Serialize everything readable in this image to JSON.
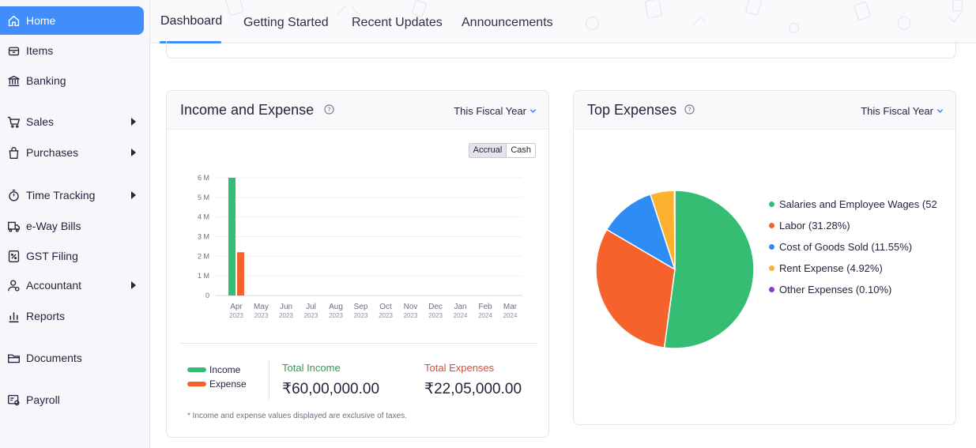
{
  "sidebar": {
    "items": [
      {
        "label": "Home",
        "icon": "home-icon",
        "active": true
      },
      {
        "label": "Items",
        "icon": "box-icon"
      },
      {
        "label": "Banking",
        "icon": "bank-icon"
      },
      {
        "label": "Sales",
        "icon": "cart-icon",
        "submenu": true
      },
      {
        "label": "Purchases",
        "icon": "bag-icon",
        "submenu": true
      },
      {
        "label": "Time Tracking",
        "icon": "stopwatch-icon",
        "submenu": true
      },
      {
        "label": "e-Way Bills",
        "icon": "truck-icon"
      },
      {
        "label": "GST Filing",
        "icon": "percent-doc-icon"
      },
      {
        "label": "Accountant",
        "icon": "accountant-icon",
        "submenu": true
      },
      {
        "label": "Reports",
        "icon": "bar-chart-icon"
      },
      {
        "label": "Documents",
        "icon": "folder-icon"
      },
      {
        "label": "Payroll",
        "icon": "payroll-icon"
      }
    ]
  },
  "tabs": [
    {
      "label": "Dashboard",
      "active": true
    },
    {
      "label": "Getting Started"
    },
    {
      "label": "Recent Updates"
    },
    {
      "label": "Announcements"
    }
  ],
  "income_expense": {
    "title": "Income and Expense",
    "period": "This Fiscal Year",
    "toggle": {
      "on": "Accrual",
      "off": "Cash"
    },
    "legend": [
      {
        "label": "Income",
        "color": "#34bd73"
      },
      {
        "label": "Expense",
        "color": "#f6622b"
      }
    ],
    "total_income_label": "Total Income",
    "total_income_value": "₹60,00,000.00",
    "total_expenses_label": "Total Expenses",
    "total_expenses_value": "₹22,05,000.00",
    "footnote": "* Income and expense values displayed are exclusive of taxes."
  },
  "top_expenses": {
    "title": "Top Expenses",
    "period": "This Fiscal Year"
  },
  "chart_data": [
    {
      "type": "bar",
      "categories": [
        "Apr 2023",
        "May 2023",
        "Jun 2023",
        "Jul 2023",
        "Aug 2023",
        "Sep 2023",
        "Oct 2023",
        "Nov 2023",
        "Dec 2023",
        "Jan 2024",
        "Feb 2024",
        "Mar 2024"
      ],
      "month_labels": [
        "Apr",
        "May",
        "Jun",
        "Jul",
        "Aug",
        "Sep",
        "Oct",
        "Nov",
        "Dec",
        "Jan",
        "Feb",
        "Mar"
      ],
      "year_labels": [
        "2023",
        "2023",
        "2023",
        "2023",
        "2023",
        "2023",
        "2023",
        "2023",
        "2023",
        "2024",
        "2024",
        "2024"
      ],
      "series": [
        {
          "name": "Income",
          "color": "#34bd73",
          "values": [
            6000000,
            0,
            0,
            0,
            0,
            0,
            0,
            0,
            0,
            0,
            0,
            0
          ]
        },
        {
          "name": "Expense",
          "color": "#f6622b",
          "values": [
            2205000,
            0,
            0,
            0,
            0,
            0,
            0,
            0,
            0,
            0,
            0,
            0
          ]
        }
      ],
      "ylim": [
        0,
        6000000
      ],
      "y_ticks": [
        0,
        1000000,
        2000000,
        3000000,
        4000000,
        5000000,
        6000000
      ],
      "y_tick_labels": [
        "0",
        "1 M",
        "2 M",
        "3 M",
        "4 M",
        "5 M",
        "6 M"
      ],
      "grid": true
    },
    {
      "type": "pie",
      "slices": [
        {
          "label": "Salaries and Employee Wages (52",
          "value": 52.15,
          "color": "#34bd73"
        },
        {
          "label": "Labor (31.28%)",
          "value": 31.28,
          "color": "#f6622b"
        },
        {
          "label": "Cost of Goods Sold (11.55%)",
          "value": 11.55,
          "color": "#2f8cf5"
        },
        {
          "label": "Rent Expense (4.92%)",
          "value": 4.92,
          "color": "#fdb22f"
        },
        {
          "label": "Other Expenses (0.10%)",
          "value": 0.1,
          "color": "#8a3ad6"
        }
      ]
    }
  ]
}
